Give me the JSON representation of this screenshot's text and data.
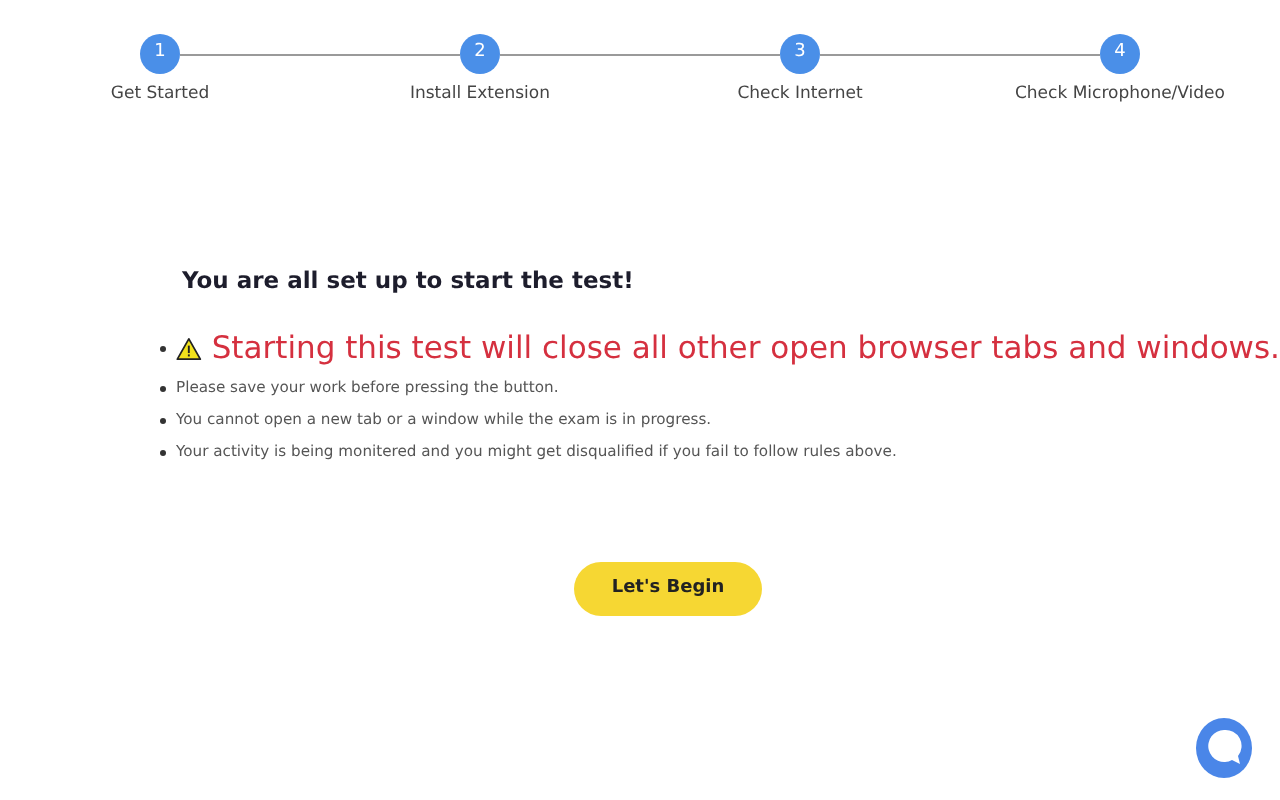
{
  "steps": [
    {
      "number": "1",
      "label": "Get Started"
    },
    {
      "number": "2",
      "label": "Install Extension"
    },
    {
      "number": "3",
      "label": "Check Internet"
    },
    {
      "number": "4",
      "label": "Check Microphone/Video"
    }
  ],
  "heading": "You are all set up to start the test!",
  "warning": "Starting this test will close all other open browser tabs and windows.",
  "rules": [
    "Please save your work before pressing the button.",
    "You cannot open a new tab or a window while the exam is in progress.",
    "Your activity is being monitered and you might get disqualified if you fail to follow rules above."
  ],
  "button": "Let's Begin"
}
